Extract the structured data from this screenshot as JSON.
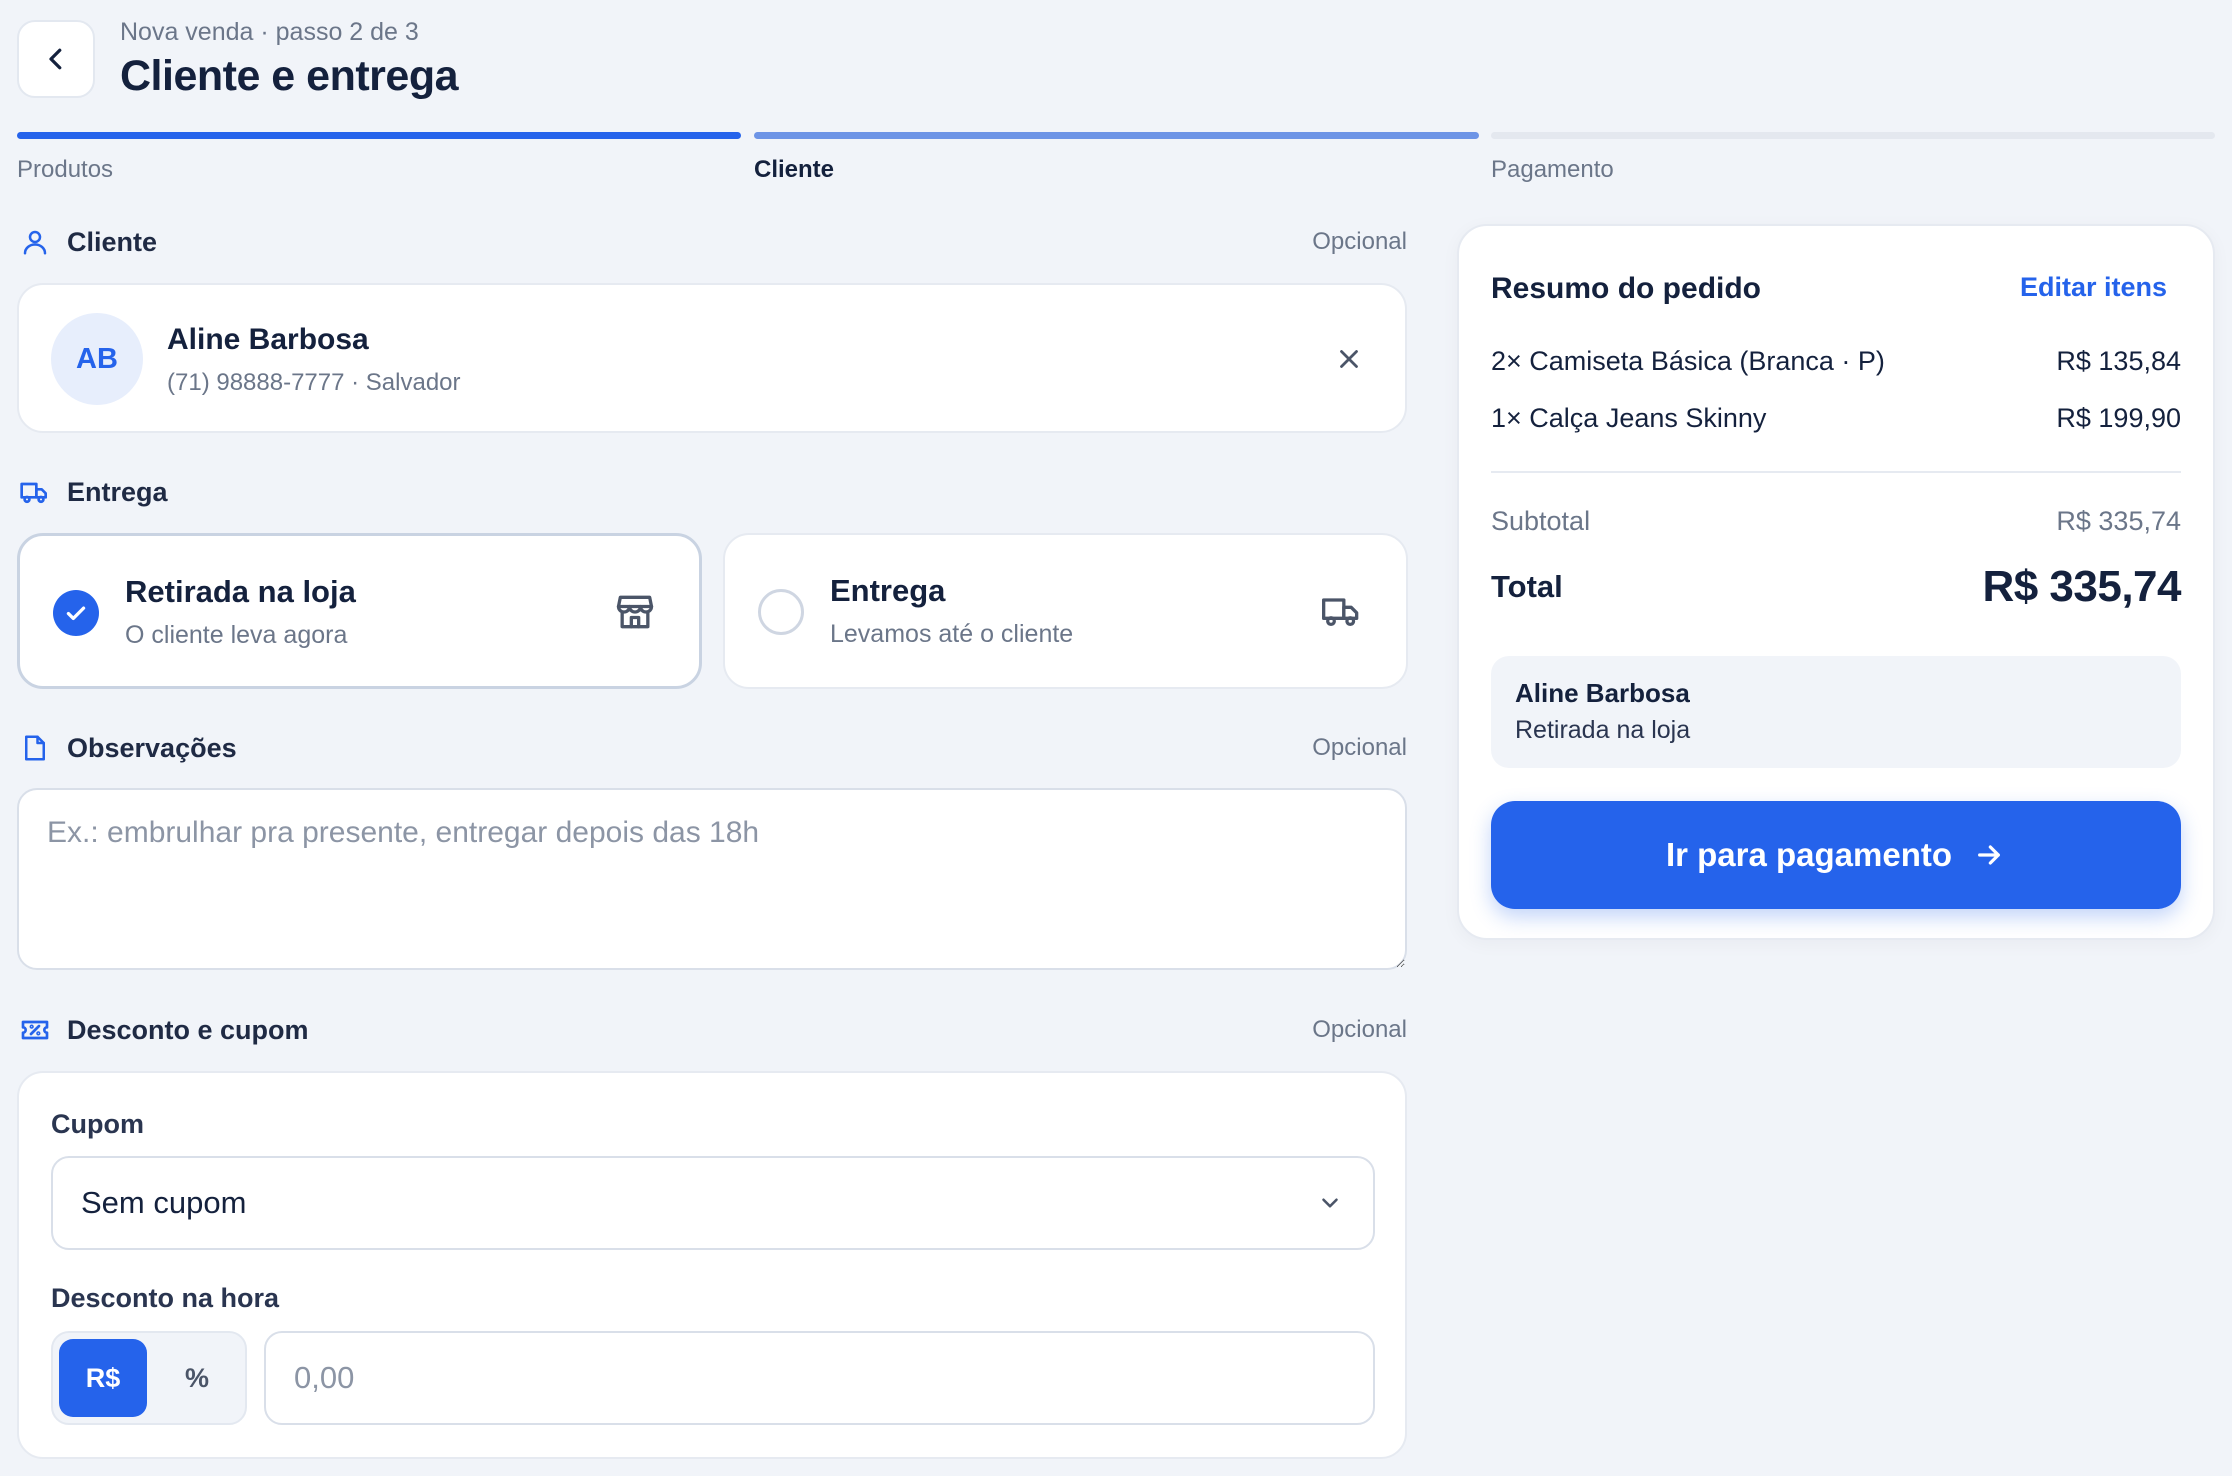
{
  "header": {
    "step": "Nova venda · passo 2 de 3",
    "title": "Cliente e entrega"
  },
  "progress": {
    "steps": [
      "Produtos",
      "Cliente",
      "Pagamento"
    ],
    "current": 2
  },
  "customer_section": {
    "title": "Cliente",
    "optional": "Opcional",
    "initials": "AB",
    "name": "Aline Barbosa",
    "details": "(71) 98888-7777 · Salvador"
  },
  "delivery_section": {
    "title": "Entrega",
    "options": [
      {
        "title": "Retirada na loja",
        "subtitle": "O cliente leva agora",
        "selected": true
      },
      {
        "title": "Entrega",
        "subtitle": "Levamos até o cliente",
        "selected": false
      }
    ]
  },
  "notes_section": {
    "title": "Observações",
    "optional": "Opcional",
    "placeholder": "Ex.: embrulhar pra presente, entregar depois das 18h",
    "value": ""
  },
  "discount_section": {
    "title": "Desconto e cupom",
    "optional": "Opcional",
    "coupon_label": "Cupom",
    "coupon_value": "Sem cupom",
    "discount_label": "Desconto na hora",
    "mode_currency": "R$",
    "mode_percent": "%",
    "amount_placeholder": "0,00"
  },
  "summary": {
    "title": "Resumo do pedido",
    "edit_label": "Editar itens",
    "items": [
      {
        "desc": "2× Camiseta Básica (Branca · P)",
        "amount": "R$ 135,84"
      },
      {
        "desc": "1× Calça Jeans Skinny",
        "amount": "R$ 199,90"
      }
    ],
    "subtotal_label": "Subtotal",
    "subtotal": "R$ 335,74",
    "total_label": "Total",
    "total": "R$ 335,74",
    "box_name": "Aline Barbosa",
    "box_mode": "Retirada na loja",
    "cta": "Ir para pagamento"
  },
  "colors": {
    "accent": "#2563eb",
    "background": "#f1f4f9",
    "text": "#14213d",
    "muted": "#6b7689"
  }
}
